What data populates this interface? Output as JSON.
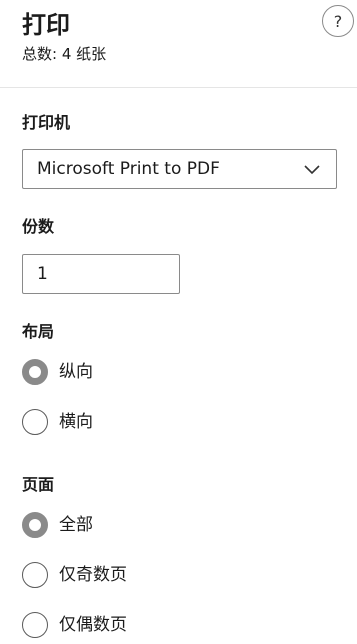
{
  "header": {
    "title": "打印",
    "subtitle": "总数: 4 纸张",
    "help_label": "?"
  },
  "printer": {
    "label": "打印机",
    "selected": "Microsoft Print to PDF",
    "icon": "chevron-down-icon"
  },
  "copies": {
    "label": "份数",
    "value": "1"
  },
  "layout": {
    "label": "布局",
    "options": [
      {
        "label": "纵向",
        "checked": true
      },
      {
        "label": "横向",
        "checked": false
      }
    ]
  },
  "pages": {
    "label": "页面",
    "options": [
      {
        "label": "全部",
        "checked": true
      },
      {
        "label": "仅奇数页",
        "checked": false
      },
      {
        "label": "仅偶数页",
        "checked": false
      }
    ]
  },
  "colors": {
    "text": "#1b1b1b",
    "border": "#8a8a8a",
    "radio_checked": "#8a8a8a",
    "divider": "#e5e5e5"
  }
}
